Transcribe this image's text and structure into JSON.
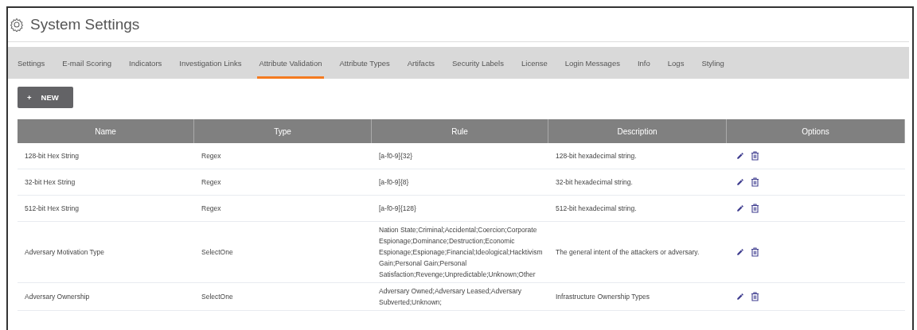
{
  "title": "System Settings",
  "tabs": [
    {
      "label": "Settings",
      "selected": false
    },
    {
      "label": "E-mail Scoring",
      "selected": false
    },
    {
      "label": "Indicators",
      "selected": false
    },
    {
      "label": "Investigation Links",
      "selected": false
    },
    {
      "label": "Attribute Validation",
      "selected": true
    },
    {
      "label": "Attribute Types",
      "selected": false
    },
    {
      "label": "Artifacts",
      "selected": false
    },
    {
      "label": "Security Labels",
      "selected": false
    },
    {
      "label": "License",
      "selected": false
    },
    {
      "label": "Login Messages",
      "selected": false
    },
    {
      "label": "Info",
      "selected": false
    },
    {
      "label": "Logs",
      "selected": false
    },
    {
      "label": "Styling",
      "selected": false
    }
  ],
  "new_button": {
    "icon": "+",
    "label": "NEW"
  },
  "table": {
    "columns": [
      "Name",
      "Type",
      "Rule",
      "Description",
      "Options"
    ],
    "rows": [
      {
        "name": "128-bit Hex String",
        "type": "Regex",
        "rule": "[a-f0-9]{32}",
        "description": "128-bit hexadecimal string."
      },
      {
        "name": "32-bit Hex String",
        "type": "Regex",
        "rule": "[a-f0-9]{8}",
        "description": "32-bit hexadecimal string."
      },
      {
        "name": "512-bit Hex String",
        "type": "Regex",
        "rule": "[a-f0-9]{128}",
        "description": "512-bit hexadecimal string."
      },
      {
        "name": "Adversary Motivation Type",
        "type": "SelectOne",
        "rule": "Nation State;Criminal;Accidental;Coercion;Corporate Espionage;Dominance;Destruction;Economic Espionage;Espionage;Financial;Ideological;Hacktivism Gain;Personal Gain;Personal Satisfaction;Revenge;Unpredictable;Unknown;Other",
        "description": "The general intent of the attackers or adversary."
      },
      {
        "name": "Adversary Ownership",
        "type": "SelectOne",
        "rule": "Adversary Owned;Adversary Leased;Adversary Subverted;Unknown;",
        "description": "Infrastructure Ownership Types"
      }
    ]
  }
}
